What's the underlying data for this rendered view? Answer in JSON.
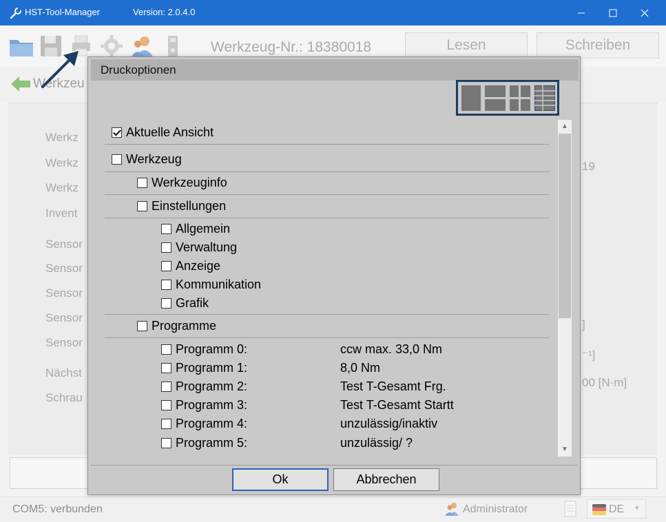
{
  "window": {
    "title": "HST-Tool-Manager",
    "version": "Version: 2.0.4.0",
    "app_icon": "wrench-icon",
    "controls": [
      "minimize-icon",
      "maximize-icon",
      "close-icon"
    ],
    "accent_color": "#1f6fd0"
  },
  "toolbar": {
    "icons": [
      "folder-icon",
      "save-icon",
      "print-icon",
      "settings-gear-icon",
      "user-icon",
      "usb-device-icon"
    ],
    "tool_number": "Werkzeug-Nr.: 18380018",
    "read_label": "Lesen",
    "write_label": "Schreiben"
  },
  "navigation": {
    "back_label": "Werkzeu"
  },
  "background_fields": {
    "labels": [
      "Werkz",
      "Werkz",
      "Werkz",
      "Invent",
      "Sensor",
      "Sensor",
      "Sensor",
      "Sensor",
      "Sensor",
      "Nächst",
      "Schrau"
    ],
    "right_values": [
      "19",
      "]",
      "⁻¹]",
      "00 [N·m]"
    ]
  },
  "dialog": {
    "title": "Druckoptionen",
    "layout_options": [
      "layout-single-icon",
      "layout-two-rows-icon",
      "layout-four-grid-icon",
      "layout-table-grid-icon"
    ],
    "selected_layout": "layout-table-grid-icon",
    "current_view": {
      "label": "Aktuelle Ansicht",
      "checked": true
    },
    "tool": {
      "label": "Werkzeug",
      "checked": false
    },
    "tool_info": {
      "label": "Werkzeuginfo",
      "checked": false
    },
    "settings": {
      "label": "Einstellungen",
      "checked": false
    },
    "settings_items": [
      {
        "label": "Allgemein",
        "checked": false
      },
      {
        "label": "Verwaltung",
        "checked": false
      },
      {
        "label": "Anzeige",
        "checked": false
      },
      {
        "label": "Kommunikation",
        "checked": false
      },
      {
        "label": "Grafik",
        "checked": false
      }
    ],
    "programs": {
      "label": "Programme",
      "checked": false
    },
    "program_items": [
      {
        "label": "Programm 0:",
        "desc": "ccw max. 33,0 Nm",
        "checked": false
      },
      {
        "label": "Programm 1:",
        "desc": "8,0 Nm",
        "checked": false
      },
      {
        "label": "Programm 2:",
        "desc": "Test T-Gesamt Frg.",
        "checked": false
      },
      {
        "label": "Programm 3:",
        "desc": "Test T-Gesamt Startt",
        "checked": false
      },
      {
        "label": "Programm 4:",
        "desc": "unzulässig/inaktiv",
        "checked": false
      },
      {
        "label": "Programm 5:",
        "desc": "unzulässig/ ?",
        "checked": false
      }
    ],
    "ok_label": "Ok",
    "cancel_label": "Abbrechen"
  },
  "status": {
    "connection": "COM5: verbunden",
    "user": "Administrator",
    "language": "DE"
  }
}
